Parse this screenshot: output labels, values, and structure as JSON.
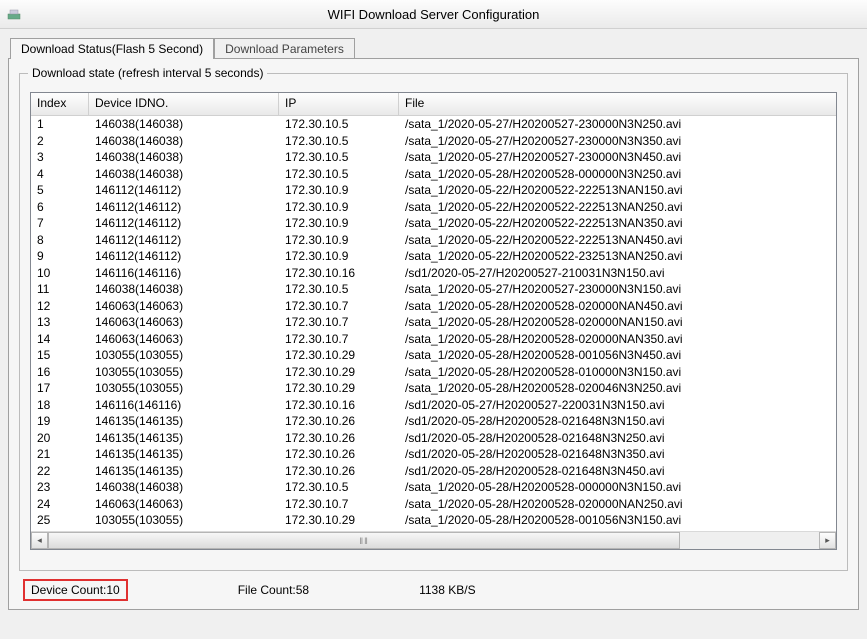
{
  "window": {
    "title": "WIFI Download Server Configuration"
  },
  "tabs": {
    "status": "Download Status(Flash 5 Second)",
    "params": "Download Parameters"
  },
  "group": {
    "title": "Download state (refresh interval 5 seconds)"
  },
  "columns": {
    "index": "Index",
    "device": "Device IDNO.",
    "ip": "IP",
    "file": "File"
  },
  "rows": [
    {
      "i": "1",
      "d": "146038(146038)",
      "ip": "172.30.10.5",
      "f": "/sata_1/2020-05-27/H20200527-230000N3N250.avi"
    },
    {
      "i": "2",
      "d": "146038(146038)",
      "ip": "172.30.10.5",
      "f": "/sata_1/2020-05-27/H20200527-230000N3N350.avi"
    },
    {
      "i": "3",
      "d": "146038(146038)",
      "ip": "172.30.10.5",
      "f": "/sata_1/2020-05-27/H20200527-230000N3N450.avi"
    },
    {
      "i": "4",
      "d": "146038(146038)",
      "ip": "172.30.10.5",
      "f": "/sata_1/2020-05-28/H20200528-000000N3N250.avi"
    },
    {
      "i": "5",
      "d": "146112(146112)",
      "ip": "172.30.10.9",
      "f": "/sata_1/2020-05-22/H20200522-222513NAN150.avi"
    },
    {
      "i": "6",
      "d": "146112(146112)",
      "ip": "172.30.10.9",
      "f": "/sata_1/2020-05-22/H20200522-222513NAN250.avi"
    },
    {
      "i": "7",
      "d": "146112(146112)",
      "ip": "172.30.10.9",
      "f": "/sata_1/2020-05-22/H20200522-222513NAN350.avi"
    },
    {
      "i": "8",
      "d": "146112(146112)",
      "ip": "172.30.10.9",
      "f": "/sata_1/2020-05-22/H20200522-222513NAN450.avi"
    },
    {
      "i": "9",
      "d": "146112(146112)",
      "ip": "172.30.10.9",
      "f": "/sata_1/2020-05-22/H20200522-232513NAN250.avi"
    },
    {
      "i": "10",
      "d": "146116(146116)",
      "ip": "172.30.10.16",
      "f": "/sd1/2020-05-27/H20200527-210031N3N150.avi"
    },
    {
      "i": "11",
      "d": "146038(146038)",
      "ip": "172.30.10.5",
      "f": "/sata_1/2020-05-27/H20200527-230000N3N150.avi"
    },
    {
      "i": "12",
      "d": "146063(146063)",
      "ip": "172.30.10.7",
      "f": "/sata_1/2020-05-28/H20200528-020000NAN450.avi"
    },
    {
      "i": "13",
      "d": "146063(146063)",
      "ip": "172.30.10.7",
      "f": "/sata_1/2020-05-28/H20200528-020000NAN150.avi"
    },
    {
      "i": "14",
      "d": "146063(146063)",
      "ip": "172.30.10.7",
      "f": "/sata_1/2020-05-28/H20200528-020000NAN350.avi"
    },
    {
      "i": "15",
      "d": "103055(103055)",
      "ip": "172.30.10.29",
      "f": "/sata_1/2020-05-28/H20200528-001056N3N450.avi"
    },
    {
      "i": "16",
      "d": "103055(103055)",
      "ip": "172.30.10.29",
      "f": "/sata_1/2020-05-28/H20200528-010000N3N150.avi"
    },
    {
      "i": "17",
      "d": "103055(103055)",
      "ip": "172.30.10.29",
      "f": "/sata_1/2020-05-28/H20200528-020046N3N250.avi"
    },
    {
      "i": "18",
      "d": "146116(146116)",
      "ip": "172.30.10.16",
      "f": "/sd1/2020-05-27/H20200527-220031N3N150.avi"
    },
    {
      "i": "19",
      "d": "146135(146135)",
      "ip": "172.30.10.26",
      "f": "/sd1/2020-05-28/H20200528-021648N3N150.avi"
    },
    {
      "i": "20",
      "d": "146135(146135)",
      "ip": "172.30.10.26",
      "f": "/sd1/2020-05-28/H20200528-021648N3N250.avi"
    },
    {
      "i": "21",
      "d": "146135(146135)",
      "ip": "172.30.10.26",
      "f": "/sd1/2020-05-28/H20200528-021648N3N350.avi"
    },
    {
      "i": "22",
      "d": "146135(146135)",
      "ip": "172.30.10.26",
      "f": "/sd1/2020-05-28/H20200528-021648N3N450.avi"
    },
    {
      "i": "23",
      "d": "146038(146038)",
      "ip": "172.30.10.5",
      "f": "/sata_1/2020-05-28/H20200528-000000N3N150.avi"
    },
    {
      "i": "24",
      "d": "146063(146063)",
      "ip": "172.30.10.7",
      "f": "/sata_1/2020-05-28/H20200528-020000NAN250.avi"
    },
    {
      "i": "25",
      "d": "103055(103055)",
      "ip": "172.30.10.29",
      "f": "/sata_1/2020-05-28/H20200528-001056N3N150.avi"
    }
  ],
  "status": {
    "device_count": "Device Count:10",
    "file_count": "File Count:58",
    "speed": "1138 KB/S"
  }
}
